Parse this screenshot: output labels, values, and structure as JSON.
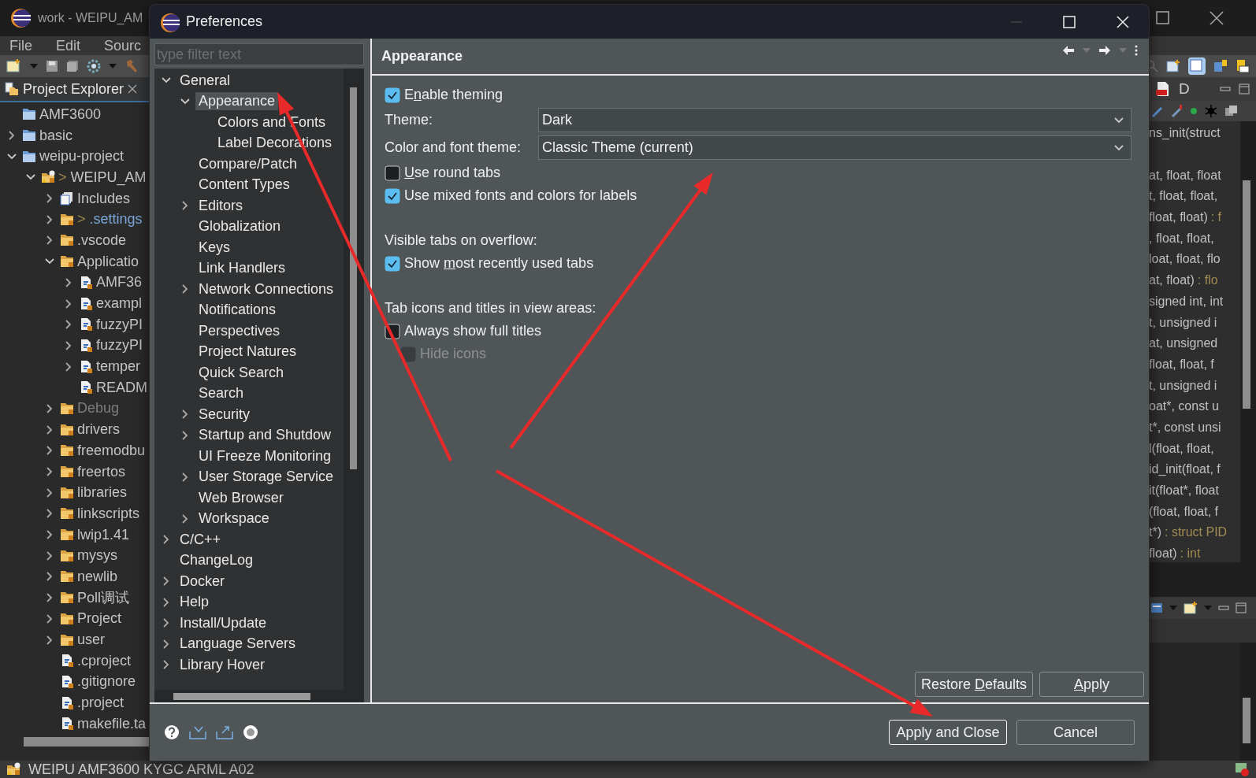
{
  "ide": {
    "window_title": "work - WEIPU_AM",
    "menu": [
      "File",
      "Edit",
      "Sourc"
    ],
    "project_explorer": {
      "title": "Project Explorer",
      "tree": [
        {
          "label": "AMF3600",
          "kind": "project"
        },
        {
          "label": "basic",
          "kind": "project",
          "expanded": false
        },
        {
          "label": "weipu-project",
          "kind": "project",
          "expanded": true,
          "children": [
            {
              "label": "WEIPU_AM",
              "prefix": ">",
              "kind": "c-project",
              "expanded": true,
              "children": [
                {
                  "label": "Includes",
                  "kind": "includes",
                  "expanded": false
                },
                {
                  "label": ".settings",
                  "prefix": ">",
                  "changed": true,
                  "kind": "folder",
                  "expanded": false
                },
                {
                  "label": ".vscode",
                  "kind": "folder",
                  "expanded": false
                },
                {
                  "label": "Applicatio",
                  "kind": "folder",
                  "expanded": true,
                  "children": [
                    {
                      "label": "AMF36",
                      "kind": "file",
                      "expanded": false
                    },
                    {
                      "label": "exampl",
                      "kind": "file",
                      "expanded": false
                    },
                    {
                      "label": "fuzzyPI",
                      "kind": "file",
                      "expanded": false
                    },
                    {
                      "label": "fuzzyPI",
                      "kind": "file",
                      "expanded": false
                    },
                    {
                      "label": "temper",
                      "kind": "file",
                      "expanded": false
                    },
                    {
                      "label": "READM",
                      "kind": "file"
                    }
                  ]
                },
                {
                  "label": "Debug",
                  "kind": "folder",
                  "derived": true,
                  "expanded": false
                },
                {
                  "label": "drivers",
                  "kind": "folder",
                  "expanded": false
                },
                {
                  "label": "freemodbu",
                  "kind": "folder",
                  "expanded": false
                },
                {
                  "label": "freertos",
                  "kind": "folder",
                  "expanded": false
                },
                {
                  "label": "libraries",
                  "kind": "folder",
                  "expanded": false
                },
                {
                  "label": "linkscripts",
                  "kind": "folder",
                  "expanded": false
                },
                {
                  "label": "lwip1.41",
                  "kind": "folder",
                  "expanded": false
                },
                {
                  "label": "mysys",
                  "kind": "folder",
                  "expanded": false
                },
                {
                  "label": "newlib",
                  "kind": "folder",
                  "expanded": false
                },
                {
                  "label": "Poll调试",
                  "kind": "folder",
                  "expanded": false
                },
                {
                  "label": "Project",
                  "kind": "folder",
                  "expanded": false
                },
                {
                  "label": "user",
                  "kind": "folder",
                  "expanded": false
                },
                {
                  "label": ".cproject",
                  "kind": "file"
                },
                {
                  "label": ".gitignore",
                  "kind": "file"
                },
                {
                  "label": ".project",
                  "kind": "file"
                },
                {
                  "label": "makefile.ta",
                  "kind": "file"
                }
              ]
            }
          ]
        }
      ]
    },
    "editor_tab": "D",
    "outline": [
      {
        "signature": "ns_init(struct"
      },
      {
        "signature": "at, float, float"
      },
      {
        "signature": "t, float, float,"
      },
      {
        "signature": "float, float)",
        "return_type": ": f"
      },
      {
        "signature": ", float, float,"
      },
      {
        "signature": "loat, float, flo"
      },
      {
        "signature": "at, float)",
        "return_type": ": flo"
      },
      {
        "signature": "signed int, int"
      },
      {
        "signature": "t, unsigned i"
      },
      {
        "signature": "at, unsigned"
      },
      {
        "signature": "float, float, f"
      },
      {
        "signature": "t, unsigned i"
      },
      {
        "signature": "oat*, const u"
      },
      {
        "signature": "t*, const unsi"
      },
      {
        "signature": "l(float, float,"
      },
      {
        "signature": "id_init(float, f"
      },
      {
        "signature": "it(float*, float"
      },
      {
        "signature": "(float, float, f"
      },
      {
        "signature": "t*)",
        "return_type": ": struct PID"
      },
      {
        "signature": "float)",
        "return_type": ": int"
      }
    ],
    "status_bar": "WEIPU AMF3600 KYGC ARML A02"
  },
  "dialog": {
    "title": "Preferences",
    "filter": {
      "placeholder": "type filter text"
    },
    "tree": [
      {
        "label": "General",
        "expanded": true,
        "selected": false,
        "children": [
          {
            "label": "Appearance",
            "expanded": true,
            "selected": true,
            "children": [
              {
                "label": "Colors and Fonts",
                "selected": false
              },
              {
                "label": "Label Decorations",
                "selected": false
              }
            ]
          },
          {
            "label": "Compare/Patch",
            "selected": false
          },
          {
            "label": "Content Types",
            "selected": false
          },
          {
            "label": "Editors",
            "expanded": false,
            "selected": false
          },
          {
            "label": "Globalization",
            "selected": false
          },
          {
            "label": "Keys",
            "selected": false
          },
          {
            "label": "Link Handlers",
            "selected": false
          },
          {
            "label": "Network Connections",
            "expanded": false,
            "selected": false
          },
          {
            "label": "Notifications",
            "selected": false
          },
          {
            "label": "Perspectives",
            "selected": false
          },
          {
            "label": "Project Natures",
            "selected": false
          },
          {
            "label": "Quick Search",
            "selected": false
          },
          {
            "label": "Search",
            "selected": false
          },
          {
            "label": "Security",
            "expanded": false,
            "selected": false
          },
          {
            "label": "Startup and Shutdow",
            "expanded": false,
            "selected": false
          },
          {
            "label": "UI Freeze Monitoring",
            "selected": false
          },
          {
            "label": "User Storage Service",
            "expanded": false,
            "selected": false
          },
          {
            "label": "Web Browser",
            "selected": false
          },
          {
            "label": "Workspace",
            "expanded": false,
            "selected": false
          }
        ]
      },
      {
        "label": "C/C++",
        "expanded": false,
        "selected": false
      },
      {
        "label": "ChangeLog",
        "selected": false
      },
      {
        "label": "Docker",
        "expanded": false,
        "selected": false
      },
      {
        "label": "Help",
        "expanded": false,
        "selected": false
      },
      {
        "label": "Install/Update",
        "expanded": false,
        "selected": false
      },
      {
        "label": "Language Servers",
        "expanded": false,
        "selected": false
      },
      {
        "label": "Library Hover",
        "expanded": false,
        "selected": false
      }
    ],
    "page": {
      "title": "Appearance",
      "options": [
        {
          "kind": "checkbox",
          "label": {
            "before": "E",
            "key": "n",
            "after": "able theming"
          },
          "checked": true,
          "disabled": false
        },
        {
          "kind": "combo",
          "label": "Theme:",
          "value": "Dark"
        },
        {
          "kind": "combo",
          "label": "Color and font theme:",
          "value": "Classic Theme (current)"
        },
        {
          "kind": "checkbox",
          "label": {
            "key": "U",
            "after": "se round tabs"
          },
          "checked": false,
          "disabled": false
        },
        {
          "kind": "checkbox",
          "label": {
            "before": "Use mixed fonts and colors for labels"
          },
          "checked": true,
          "disabled": false
        },
        {
          "kind": "heading",
          "label": "Visible tabs on overflow:"
        },
        {
          "kind": "checkbox",
          "label": {
            "before": "Show ",
            "key": "m",
            "after": "ost recently used tabs"
          },
          "checked": true,
          "disabled": false
        },
        {
          "kind": "heading",
          "label": "Tab icons and titles in view areas:"
        },
        {
          "kind": "checkbox",
          "label": {
            "before": "Always show full titles"
          },
          "checked": false,
          "disabled": false
        },
        {
          "kind": "sub-checkbox",
          "label": {
            "before": "Hide icons"
          },
          "checked": false,
          "disabled": true
        }
      ],
      "buttons": [
        {
          "before": "Restore ",
          "key": "D",
          "after": "efaults"
        },
        {
          "key": "A",
          "after": "pply"
        }
      ]
    },
    "footer_buttons": [
      {
        "label": "Apply and Close",
        "default": true
      },
      {
        "label": "Cancel",
        "default": false
      }
    ]
  }
}
